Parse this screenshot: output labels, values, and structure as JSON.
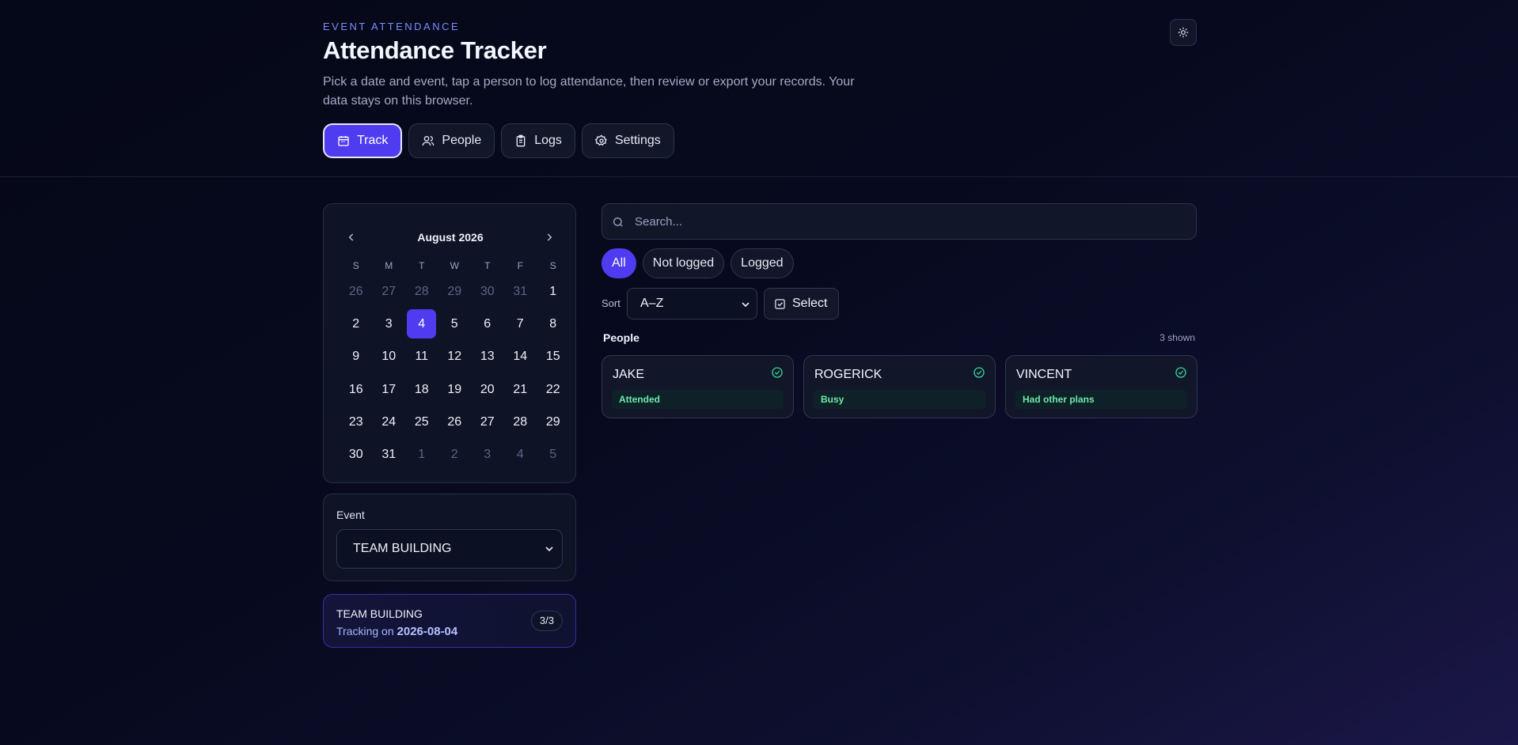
{
  "header": {
    "eyebrow": "EVENT ATTENDANCE",
    "title": "Attendance Tracker",
    "subtitle": "Pick a date and event, tap a person to log attendance, then review or export your records. Your data stays on this browser.",
    "theme_icon": "sun-icon"
  },
  "tabs": [
    {
      "label": "Track",
      "icon": "calendar-icon",
      "active": true
    },
    {
      "label": "People",
      "icon": "users-icon",
      "active": false
    },
    {
      "label": "Logs",
      "icon": "clipboard-icon",
      "active": false
    },
    {
      "label": "Settings",
      "icon": "gear-icon",
      "active": false
    }
  ],
  "calendar": {
    "month_label": "August 2026",
    "weekdays": [
      "S",
      "M",
      "T",
      "W",
      "T",
      "F",
      "S"
    ],
    "days": [
      {
        "d": "26",
        "muted": true
      },
      {
        "d": "27",
        "muted": true
      },
      {
        "d": "28",
        "muted": true
      },
      {
        "d": "29",
        "muted": true
      },
      {
        "d": "30",
        "muted": true
      },
      {
        "d": "31",
        "muted": true
      },
      {
        "d": "1"
      },
      {
        "d": "2"
      },
      {
        "d": "3"
      },
      {
        "d": "4",
        "selected": true
      },
      {
        "d": "5"
      },
      {
        "d": "6"
      },
      {
        "d": "7"
      },
      {
        "d": "8"
      },
      {
        "d": "9"
      },
      {
        "d": "10"
      },
      {
        "d": "11"
      },
      {
        "d": "12"
      },
      {
        "d": "13"
      },
      {
        "d": "14"
      },
      {
        "d": "15"
      },
      {
        "d": "16"
      },
      {
        "d": "17"
      },
      {
        "d": "18"
      },
      {
        "d": "19"
      },
      {
        "d": "20"
      },
      {
        "d": "21"
      },
      {
        "d": "22"
      },
      {
        "d": "23"
      },
      {
        "d": "24"
      },
      {
        "d": "25"
      },
      {
        "d": "26"
      },
      {
        "d": "27"
      },
      {
        "d": "28"
      },
      {
        "d": "29"
      },
      {
        "d": "30"
      },
      {
        "d": "31"
      },
      {
        "d": "1",
        "muted": true
      },
      {
        "d": "2",
        "muted": true
      },
      {
        "d": "3",
        "muted": true
      },
      {
        "d": "4",
        "muted": true
      },
      {
        "d": "5",
        "muted": true
      }
    ]
  },
  "event": {
    "label": "Event",
    "selected": "TEAM BUILDING"
  },
  "summary": {
    "name": "TEAM BUILDING",
    "tracking_prefix": "Tracking on",
    "date": "2026-08-04",
    "count": "3/3"
  },
  "search": {
    "placeholder": "Search..."
  },
  "filters": [
    {
      "label": "All",
      "active": true
    },
    {
      "label": "Not logged",
      "active": false
    },
    {
      "label": "Logged",
      "active": false
    }
  ],
  "sort": {
    "label": "Sort",
    "value": "A–Z"
  },
  "select_button": {
    "label": "Select"
  },
  "people": {
    "heading": "People",
    "shown": "3 shown",
    "items": [
      {
        "name": "JAKE",
        "status": "Attended"
      },
      {
        "name": "ROGERICK",
        "status": "Busy"
      },
      {
        "name": "VINCENT",
        "status": "Had other plans"
      }
    ]
  },
  "colors": {
    "accent": "#4f3cf0",
    "status_text": "#6ee7a8",
    "check": "#34d399"
  }
}
